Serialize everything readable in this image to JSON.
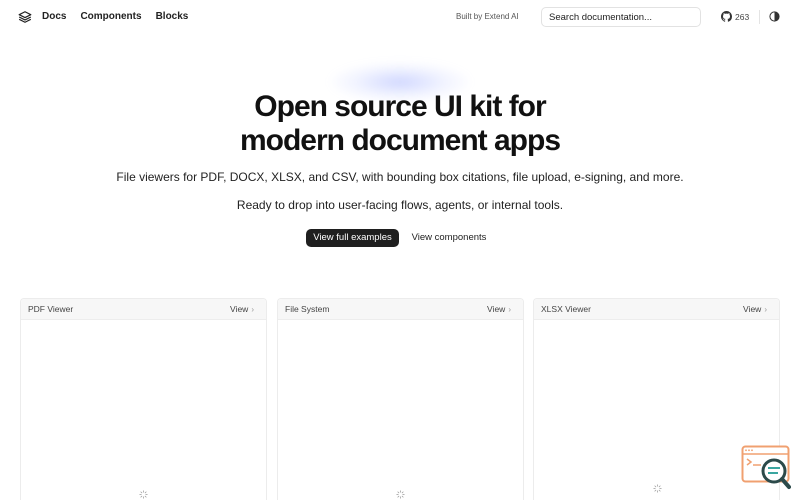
{
  "header": {
    "nav": [
      "Docs",
      "Components",
      "Blocks"
    ],
    "built_by": "Built by Extend AI",
    "search_placeholder": "Search documentation...",
    "github_stars": "263"
  },
  "hero": {
    "title_line1": "Open source UI kit for",
    "title_line2": "modern document apps",
    "subtitle1": "File viewers for PDF, DOCX, XLSX, and CSV, with bounding box citations, file upload, e-signing, and more.",
    "subtitle2": "Ready to drop into user-facing flows, agents, or internal tools.",
    "primary_button": "View full examples",
    "secondary_button": "View components"
  },
  "cards": [
    {
      "title": "PDF Viewer",
      "view": "View"
    },
    {
      "title": "File System",
      "view": "View"
    },
    {
      "title": "XLSX Viewer",
      "view": "View"
    }
  ],
  "colors": {
    "primary_button_bg": "#1f1f1f",
    "widget_accent": "#f0a070"
  },
  "icons": {
    "logo": "layers-icon",
    "github": "github-icon",
    "theme": "contrast-icon",
    "spinner": "loading-spinner-icon",
    "widget": "code-search-icon"
  }
}
